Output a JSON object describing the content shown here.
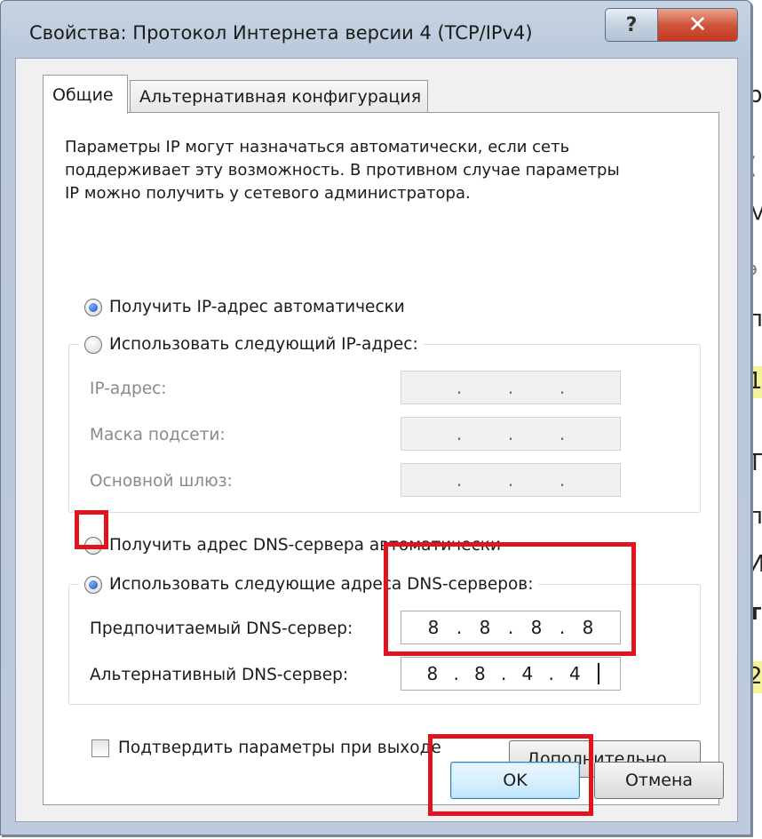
{
  "window": {
    "title": "Свойства: Протокол Интернета версии 4 (TCP/IPv4)",
    "help_glyph": "?",
    "close_glyph": "✕"
  },
  "tabs": [
    {
      "label": "Общие",
      "active": true
    },
    {
      "label": "Альтернативная конфигурация",
      "active": false
    }
  ],
  "description": [
    "Параметры IP могут назначаться автоматически, если сеть",
    "поддерживает эту возможность. В противном случае параметры",
    "IP можно получить у сетевого администратора."
  ],
  "ip_settings": {
    "auto_label": "Получить IP-адрес автоматически",
    "manual_label": "Использовать следующий IP-адрес:",
    "auto_selected": true,
    "fields": [
      {
        "label": "IP-адрес:",
        "value": [
          "",
          "",
          "",
          ""
        ]
      },
      {
        "label": "Маска подсети:",
        "value": [
          "",
          "",
          "",
          ""
        ]
      },
      {
        "label": "Основной шлюз:",
        "value": [
          "",
          "",
          "",
          ""
        ]
      }
    ]
  },
  "dns_settings": {
    "auto_label": "Получить адрес DNS-сервера автоматически",
    "manual_label": "Использовать следующие адреса DNS-серверов:",
    "manual_selected": true,
    "preferred": {
      "label": "Предпочитаемый DNS-сервер:",
      "value": [
        "8",
        "8",
        "8",
        "8"
      ]
    },
    "alternate": {
      "label": "Альтернативный DNS-сервер:",
      "value": [
        "8",
        "8",
        "4",
        "4"
      ]
    }
  },
  "validate": {
    "label": "Подтвердить параметры при выходе",
    "checked": false
  },
  "buttons": {
    "advanced": "Дополнительно...",
    "ok": "OK",
    "cancel": "Отмена"
  },
  "background_page": {
    "glyphs": [
      "р",
      "(",
      "М",
      "э",
      "п",
      "1",
      "Т",
      "п",
      "И",
      "т",
      "2"
    ]
  },
  "colors": {
    "annotation_red": "#e0131e",
    "close_button": "#c2381f",
    "highlight_yellow": "#f4f39a"
  }
}
